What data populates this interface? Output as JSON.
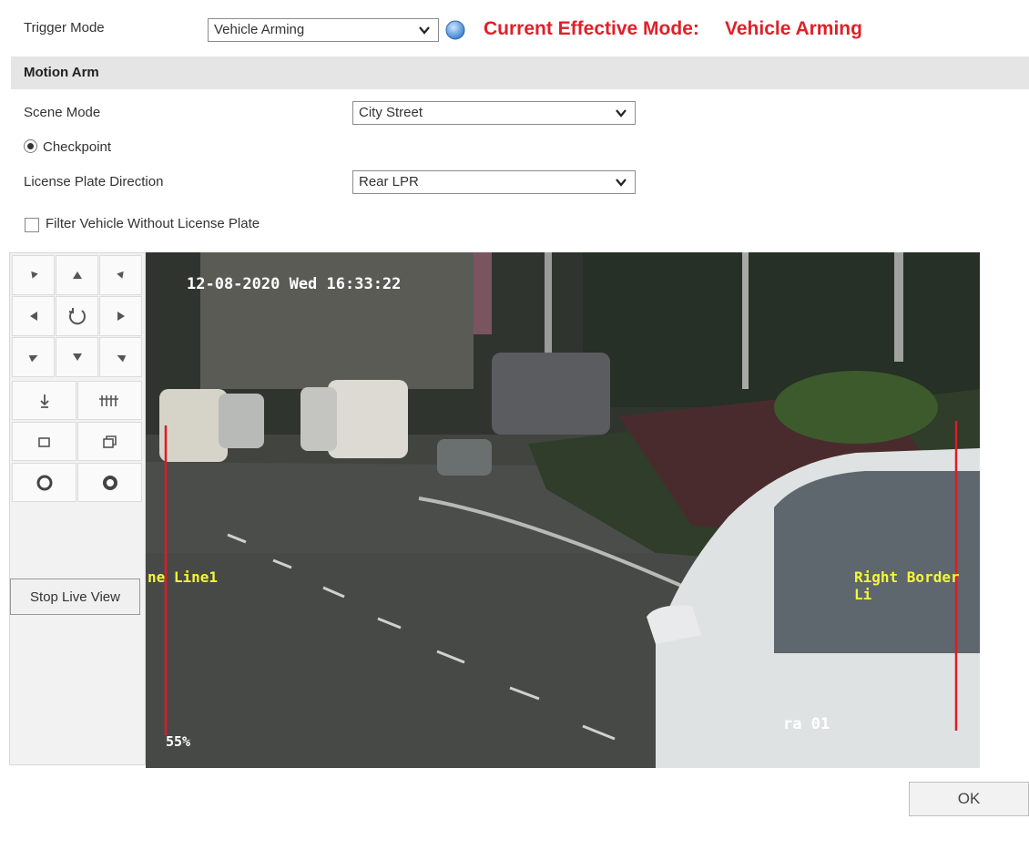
{
  "trigger": {
    "label": "Trigger Mode",
    "selected": "Vehicle Arming",
    "effective_label": "Current Effective Mode:",
    "effective_value": "Vehicle Arming"
  },
  "section": {
    "title": "Motion Arm"
  },
  "scene": {
    "label": "Scene Mode",
    "selected": "City Street"
  },
  "checkpoint": {
    "label": "Checkpoint",
    "checked": true
  },
  "plate_direction": {
    "label": "License Plate Direction",
    "selected": "Rear LPR"
  },
  "filter": {
    "label": "Filter Vehicle Without License Plate",
    "checked": false
  },
  "live_view": {
    "timestamp": "12-08-2020 Wed 16:33:22",
    "left_line_label": "ne Line1",
    "right_line_label": "Right Border Li",
    "zoom": "55%",
    "camera_name": "ra 01",
    "line_color": "#e01a2a",
    "label_color": "#f5f53a"
  },
  "ptz": {
    "icons": [
      "arrow-up-left-icon",
      "arrow-up-icon",
      "arrow-up-right-icon",
      "arrow-left-icon",
      "auto-scan-icon",
      "arrow-right-icon",
      "arrow-down-left-icon",
      "arrow-down-icon",
      "arrow-down-right-icon"
    ],
    "tool_icons": [
      "zoom-in-icon",
      "zoom-out-icon",
      "focus-near-icon",
      "focus-far-icon",
      "iris-open-icon",
      "iris-close-icon"
    ]
  },
  "buttons": {
    "stop_live_view": "Stop Live View",
    "ok": "OK"
  },
  "colors": {
    "accent_red": "#e0202a",
    "section_bg": "#e5e5e5"
  }
}
